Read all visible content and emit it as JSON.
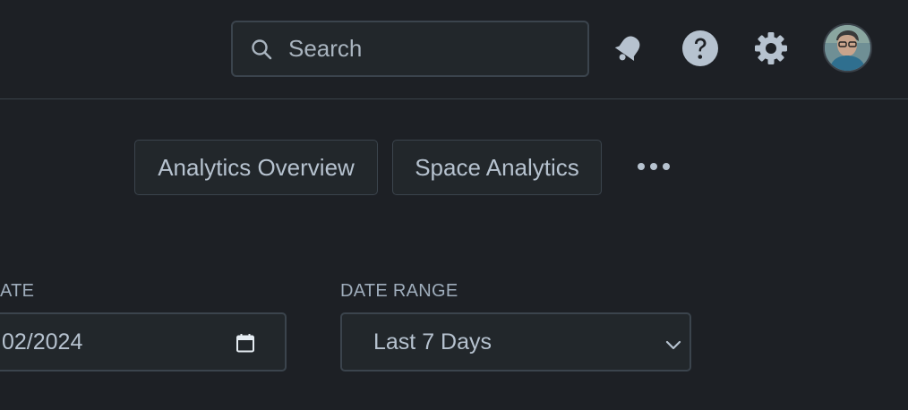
{
  "header": {
    "search": {
      "placeholder": "Search",
      "icon": "search-icon"
    },
    "icons": [
      "notification-bell-icon",
      "help-icon",
      "settings-gear-icon"
    ],
    "avatar": "user-avatar"
  },
  "tabs": [
    {
      "label": "Analytics Overview"
    },
    {
      "label": "Space Analytics"
    }
  ],
  "more_menu": {
    "icon": "more-horizontal-icon"
  },
  "filters": {
    "date": {
      "label": "ATE",
      "value": "02/2024",
      "icon": "calendar-icon"
    },
    "date_range": {
      "label": "DATE RANGE",
      "value": "Last 7 Days",
      "icon": "chevron-down-icon"
    }
  },
  "colors": {
    "background": "#1d2025",
    "surface": "#22272b",
    "border": "#3b444d",
    "text": "#b6c2cf",
    "muted": "#9fadbc"
  }
}
